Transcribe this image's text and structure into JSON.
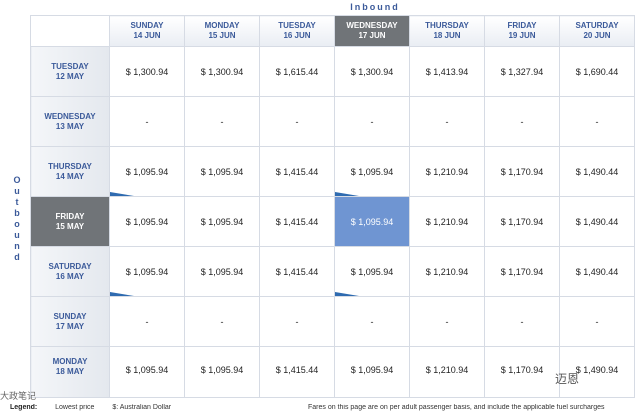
{
  "header": {
    "inbound": "Inbound",
    "outbound": "Outbound"
  },
  "columns": [
    {
      "day": "SUNDAY",
      "date": "14 JUN"
    },
    {
      "day": "MONDAY",
      "date": "15 JUN"
    },
    {
      "day": "TUESDAY",
      "date": "16 JUN"
    },
    {
      "day": "WEDNESDAY",
      "date": "17 JUN"
    },
    {
      "day": "THURSDAY",
      "date": "18 JUN"
    },
    {
      "day": "FRIDAY",
      "date": "19 JUN"
    },
    {
      "day": "SATURDAY",
      "date": "20 JUN"
    }
  ],
  "rows": [
    {
      "day": "TUESDAY",
      "date": "12 MAY",
      "fares": [
        "$ 1,300.94",
        "$ 1,300.94",
        "$ 1,615.44",
        "$ 1,300.94",
        "$ 1,413.94",
        "$ 1,327.94",
        "$ 1,690.44"
      ]
    },
    {
      "day": "WEDNESDAY",
      "date": "13 MAY",
      "fares": [
        "-",
        "-",
        "-",
        "-",
        "-",
        "-",
        "-"
      ]
    },
    {
      "day": "THURSDAY",
      "date": "14 MAY",
      "fares": [
        "$ 1,095.94",
        "$ 1,095.94",
        "$ 1,415.44",
        "$ 1,095.94",
        "$ 1,210.94",
        "$ 1,170.94",
        "$ 1,490.44"
      ]
    },
    {
      "day": "FRIDAY",
      "date": "15 MAY",
      "fares": [
        "$ 1,095.94",
        "$ 1,095.94",
        "$ 1,415.44",
        "$ 1,095.94",
        "$ 1,210.94",
        "$ 1,170.94",
        "$ 1,490.44"
      ]
    },
    {
      "day": "SATURDAY",
      "date": "16 MAY",
      "fares": [
        "$ 1,095.94",
        "$ 1,095.94",
        "$ 1,415.44",
        "$ 1,095.94",
        "$ 1,210.94",
        "$ 1,170.94",
        "$ 1,490.44"
      ]
    },
    {
      "day": "SUNDAY",
      "date": "17 MAY",
      "fares": [
        "-",
        "-",
        "-",
        "-",
        "-",
        "-",
        "-"
      ]
    },
    {
      "day": "MONDAY",
      "date": "18 MAY",
      "fares": [
        "$ 1,095.94",
        "$ 1,095.94",
        "$ 1,415.44",
        "$ 1,095.94",
        "$ 1,210.94",
        "$ 1,170.94",
        "$ 1,490.94"
      ]
    }
  ],
  "footer": {
    "legend_label": "Legend:",
    "lowest_price": "Lowest price",
    "currency": "$: Australian Dollar",
    "note": "Fares on this page are on per adult passenger basis, and include the applicable fuel surcharges"
  },
  "watermarks": {
    "left": "大政笔记",
    "right": "迈恩"
  },
  "colors": {
    "header_text": "#3b5a9a",
    "selected_header": "#707478",
    "selected_cell": "#6f95d2",
    "lowest_marker": "#2f6bb0"
  }
}
